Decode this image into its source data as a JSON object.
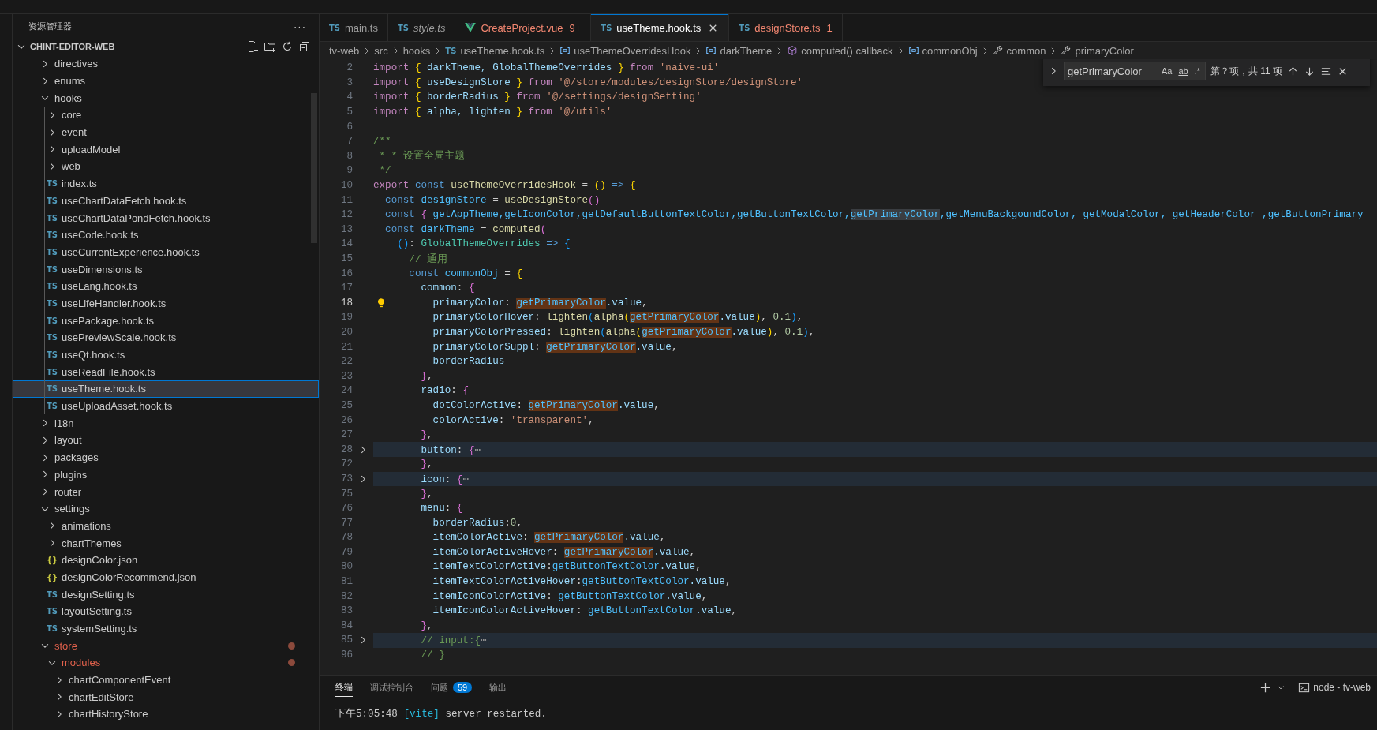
{
  "explorer": {
    "title": "资源管理器",
    "more": "···",
    "project": {
      "name": "CHINT-EDITOR-WEB",
      "expanded": true
    },
    "tree": [
      {
        "label": "directives",
        "kind": "folder",
        "expanded": false,
        "selected": false,
        "modified": false
      },
      {
        "label": "enums",
        "kind": "folder",
        "expanded": false,
        "selected": false,
        "modified": false
      },
      {
        "label": "hooks",
        "kind": "folder",
        "expanded": true,
        "selected": false,
        "modified": false,
        "children": [
          {
            "label": "core",
            "kind": "folder",
            "expanded": false,
            "selected": false,
            "modified": false
          },
          {
            "label": "event",
            "kind": "folder",
            "expanded": false,
            "selected": false,
            "modified": false
          },
          {
            "label": "uploadModel",
            "kind": "folder",
            "expanded": false,
            "selected": false,
            "modified": false
          },
          {
            "label": "web",
            "kind": "folder",
            "expanded": false,
            "selected": false,
            "modified": false
          },
          {
            "label": "index.ts",
            "kind": "ts",
            "icon": "TS",
            "selected": false,
            "modified": false
          },
          {
            "label": "useChartDataFetch.hook.ts",
            "kind": "ts",
            "icon": "TS",
            "selected": false,
            "modified": false
          },
          {
            "label": "useChartDataPondFetch.hook.ts",
            "kind": "ts",
            "icon": "TS",
            "selected": false,
            "modified": false
          },
          {
            "label": "useCode.hook.ts",
            "kind": "ts",
            "icon": "TS",
            "selected": false,
            "modified": false
          },
          {
            "label": "useCurrentExperience.hook.ts",
            "kind": "ts",
            "icon": "TS",
            "selected": false,
            "modified": false
          },
          {
            "label": "useDimensions.ts",
            "kind": "ts",
            "icon": "TS",
            "selected": false,
            "modified": false
          },
          {
            "label": "useLang.hook.ts",
            "kind": "ts",
            "icon": "TS",
            "selected": false,
            "modified": false
          },
          {
            "label": "useLifeHandler.hook.ts",
            "kind": "ts",
            "icon": "TS",
            "selected": false,
            "modified": false
          },
          {
            "label": "usePackage.hook.ts",
            "kind": "ts",
            "icon": "TS",
            "selected": false,
            "modified": false
          },
          {
            "label": "usePreviewScale.hook.ts",
            "kind": "ts",
            "icon": "TS",
            "selected": false,
            "modified": false
          },
          {
            "label": "useQt.hook.ts",
            "kind": "ts",
            "icon": "TS",
            "selected": false,
            "modified": false
          },
          {
            "label": "useReadFile.hook.ts",
            "kind": "ts",
            "icon": "TS",
            "selected": false,
            "modified": false
          },
          {
            "label": "useTheme.hook.ts",
            "kind": "ts",
            "icon": "TS",
            "selected": true,
            "modified": false
          },
          {
            "label": "useUploadAsset.hook.ts",
            "kind": "ts",
            "icon": "TS",
            "selected": false,
            "modified": false
          }
        ]
      },
      {
        "label": "i18n",
        "kind": "folder",
        "expanded": false,
        "selected": false,
        "modified": false
      },
      {
        "label": "layout",
        "kind": "folder",
        "expanded": false,
        "selected": false,
        "modified": false
      },
      {
        "label": "packages",
        "kind": "folder",
        "expanded": false,
        "selected": false,
        "modified": false
      },
      {
        "label": "plugins",
        "kind": "folder",
        "expanded": false,
        "selected": false,
        "modified": false
      },
      {
        "label": "router",
        "kind": "folder",
        "expanded": false,
        "selected": false,
        "modified": false
      },
      {
        "label": "settings",
        "kind": "folder",
        "expanded": true,
        "selected": false,
        "modified": false,
        "children": [
          {
            "label": "animations",
            "kind": "folder",
            "expanded": false,
            "selected": false,
            "modified": false
          },
          {
            "label": "chartThemes",
            "kind": "folder",
            "expanded": false,
            "selected": false,
            "modified": false
          },
          {
            "label": "designColor.json",
            "kind": "json",
            "icon": "{}",
            "selected": false,
            "modified": false
          },
          {
            "label": "designColorRecommend.json",
            "kind": "json",
            "icon": "{}",
            "selected": false,
            "modified": false
          },
          {
            "label": "designSetting.ts",
            "kind": "ts",
            "icon": "TS",
            "selected": false,
            "modified": false
          },
          {
            "label": "layoutSetting.ts",
            "kind": "ts",
            "icon": "TS",
            "selected": false,
            "modified": false
          },
          {
            "label": "systemSetting.ts",
            "kind": "ts",
            "icon": "TS",
            "selected": false,
            "modified": false
          }
        ]
      },
      {
        "label": "store",
        "kind": "folder",
        "expanded": true,
        "selected": false,
        "modified": true,
        "children": [
          {
            "label": "modules",
            "kind": "folder",
            "expanded": true,
            "selected": false,
            "modified": true,
            "children": [
              {
                "label": "chartComponentEvent",
                "kind": "folder",
                "expanded": false,
                "selected": false,
                "modified": false
              },
              {
                "label": "chartEditStore",
                "kind": "folder",
                "expanded": false,
                "selected": false,
                "modified": false
              },
              {
                "label": "chartHistoryStore",
                "kind": "folder",
                "expanded": false,
                "selected": false,
                "modified": false
              }
            ]
          }
        ]
      }
    ]
  },
  "tabs": [
    {
      "label": "main.ts",
      "kind": "ts",
      "icon": "TS",
      "selected": false,
      "preview": false,
      "error": false
    },
    {
      "label": "style.ts",
      "kind": "ts",
      "icon": "TS",
      "selected": false,
      "preview": true,
      "error": false
    },
    {
      "label": "CreateProject.vue",
      "kind": "vue",
      "selected": false,
      "preview": false,
      "error": true,
      "problems": "9+"
    },
    {
      "label": "useTheme.hook.ts",
      "kind": "ts",
      "icon": "TS",
      "selected": true,
      "preview": false,
      "error": false
    },
    {
      "label": "designStore.ts",
      "kind": "ts",
      "icon": "TS",
      "selected": false,
      "preview": false,
      "error": true,
      "problems": "1"
    }
  ],
  "breadcrumb": [
    {
      "label": "tv-web",
      "kind": "folder"
    },
    {
      "label": "src",
      "kind": "folder"
    },
    {
      "label": "hooks",
      "kind": "folder"
    },
    {
      "label": "useTheme.hook.ts",
      "kind": "ts",
      "icon": "TS"
    },
    {
      "label": "useThemeOverridesHook",
      "kind": "variable"
    },
    {
      "label": "darkTheme",
      "kind": "variable"
    },
    {
      "label": "computed() callback",
      "kind": "method"
    },
    {
      "label": "commonObj",
      "kind": "variable"
    },
    {
      "label": "common",
      "kind": "property"
    },
    {
      "label": "primaryColor",
      "kind": "property"
    }
  ],
  "find": {
    "query": "getPrimaryColor",
    "options": [
      {
        "label": "Aa",
        "on": false
      },
      {
        "label": "ab",
        "on": false
      },
      {
        "label": ".*",
        "on": false
      }
    ],
    "result": "第？项，共 11 项"
  },
  "editor": {
    "lines": [
      {
        "number": "2",
        "tokens": [
          {
            "text": "import ",
            "kind": "ctl"
          },
          {
            "text": "{",
            "kind": "b1"
          },
          {
            "text": " darkTheme, GlobalThemeOverrides ",
            "kind": "var"
          },
          {
            "text": "}",
            "kind": "b1"
          },
          {
            "text": " from ",
            "kind": "ctl"
          },
          {
            "text": "'naive-ui'",
            "kind": "str"
          }
        ]
      },
      {
        "number": "3",
        "tokens": [
          {
            "text": "import ",
            "kind": "ctl"
          },
          {
            "text": "{",
            "kind": "b1"
          },
          {
            "text": " useDesignStore ",
            "kind": "var"
          },
          {
            "text": "}",
            "kind": "b1"
          },
          {
            "text": " from ",
            "kind": "ctl"
          },
          {
            "text": "'@/store/modules/designStore/designStore'",
            "kind": "str"
          }
        ]
      },
      {
        "number": "4",
        "tokens": [
          {
            "text": "import ",
            "kind": "ctl"
          },
          {
            "text": "{",
            "kind": "b1"
          },
          {
            "text": " borderRadius ",
            "kind": "var"
          },
          {
            "text": "}",
            "kind": "b1"
          },
          {
            "text": " from ",
            "kind": "ctl"
          },
          {
            "text": "'@/settings/designSetting'",
            "kind": "str"
          }
        ]
      },
      {
        "number": "5",
        "tokens": [
          {
            "text": "import ",
            "kind": "ctl"
          },
          {
            "text": "{",
            "kind": "b1"
          },
          {
            "text": " alpha, lighten ",
            "kind": "var"
          },
          {
            "text": "}",
            "kind": "b1"
          },
          {
            "text": " from ",
            "kind": "ctl"
          },
          {
            "text": "'@/utils'",
            "kind": "str"
          }
        ]
      },
      {
        "number": "6"
      },
      {
        "number": "7",
        "tokens": [
          {
            "text": "/**",
            "kind": "com"
          }
        ]
      },
      {
        "number": "8",
        "tokens": [
          {
            "text": " * * 设置全局主题",
            "kind": "com"
          }
        ]
      },
      {
        "number": "9",
        "tokens": [
          {
            "text": " */",
            "kind": "com"
          }
        ]
      },
      {
        "number": "10",
        "tokens": [
          {
            "text": "export ",
            "kind": "ctl"
          },
          {
            "text": "const ",
            "kind": "kw"
          },
          {
            "text": "useThemeOverridesHook",
            "kind": "fn"
          },
          {
            "text": " = ",
            "kind": "p"
          },
          {
            "text": "()",
            "kind": "b1"
          },
          {
            "text": " => ",
            "kind": "kw"
          },
          {
            "text": "{",
            "kind": "b1"
          }
        ]
      },
      {
        "number": "11",
        "tokens": [
          {
            "text": "  const ",
            "kind": "kw"
          },
          {
            "text": "designStore",
            "kind": "const"
          },
          {
            "text": " = ",
            "kind": "p"
          },
          {
            "text": "useDesignStore",
            "kind": "fn"
          },
          {
            "text": "()",
            "kind": "b2"
          }
        ]
      },
      {
        "number": "12",
        "tokens": [
          {
            "text": "  const ",
            "kind": "kw"
          },
          {
            "text": "{",
            "kind": "b2"
          },
          {
            "text": " getAppTheme,getIconColor,getDefaultButtonTextColor,getButtonTextColor,",
            "kind": "const"
          },
          {
            "text": "getPrimaryColor",
            "kind": "const",
            "match": true,
            "current": true
          },
          {
            "text": ",getMenuBackgoundColor, getModalColor, getHeaderColor ,getButtonPrimary",
            "kind": "const"
          }
        ]
      },
      {
        "number": "13",
        "tokens": [
          {
            "text": "  const ",
            "kind": "kw"
          },
          {
            "text": "darkTheme",
            "kind": "const"
          },
          {
            "text": " = ",
            "kind": "p"
          },
          {
            "text": "computed",
            "kind": "fn"
          },
          {
            "text": "(",
            "kind": "b2"
          }
        ]
      },
      {
        "number": "14",
        "tokens": [
          {
            "text": "    ()",
            "kind": "b3"
          },
          {
            "text": ": ",
            "kind": "p"
          },
          {
            "text": "GlobalThemeOverrides",
            "kind": "type"
          },
          {
            "text": " => ",
            "kind": "kw"
          },
          {
            "text": "{",
            "kind": "b3"
          }
        ]
      },
      {
        "number": "15",
        "tokens": [
          {
            "text": "      // 通用",
            "kind": "com"
          }
        ]
      },
      {
        "number": "16",
        "tokens": [
          {
            "text": "      const ",
            "kind": "kw"
          },
          {
            "text": "commonObj",
            "kind": "const"
          },
          {
            "text": " = ",
            "kind": "p"
          },
          {
            "text": "{",
            "kind": "b1"
          }
        ]
      },
      {
        "number": "17",
        "tokens": [
          {
            "text": "        common",
            "kind": "var"
          },
          {
            "text": ": ",
            "kind": "p"
          },
          {
            "text": "{",
            "kind": "b2"
          }
        ]
      },
      {
        "number": "18",
        "current": true,
        "lightbulb": true,
        "tokens": [
          {
            "text": "          primaryColor",
            "kind": "var"
          },
          {
            "text": ": ",
            "kind": "p"
          },
          {
            "text": "getPrimaryColor",
            "kind": "const",
            "match": true
          },
          {
            "text": ".value",
            "kind": "var"
          },
          {
            "text": ",",
            "kind": "p"
          }
        ]
      },
      {
        "number": "19",
        "tokens": [
          {
            "text": "          primaryColorHover",
            "kind": "var"
          },
          {
            "text": ": ",
            "kind": "p"
          },
          {
            "text": "lighten",
            "kind": "fn"
          },
          {
            "text": "(",
            "kind": "b3"
          },
          {
            "text": "alpha",
            "kind": "fn"
          },
          {
            "text": "(",
            "kind": "b1"
          },
          {
            "text": "getPrimaryColor",
            "kind": "const",
            "match": true
          },
          {
            "text": ".value",
            "kind": "var"
          },
          {
            "text": ")",
            "kind": "b1"
          },
          {
            "text": ", ",
            "kind": "p"
          },
          {
            "text": "0.1",
            "kind": "num"
          },
          {
            "text": ")",
            "kind": "b3"
          },
          {
            "text": ",",
            "kind": "p"
          }
        ]
      },
      {
        "number": "20",
        "tokens": [
          {
            "text": "          primaryColorPressed",
            "kind": "var"
          },
          {
            "text": ": ",
            "kind": "p"
          },
          {
            "text": "lighten",
            "kind": "fn"
          },
          {
            "text": "(",
            "kind": "b3"
          },
          {
            "text": "alpha",
            "kind": "fn"
          },
          {
            "text": "(",
            "kind": "b1"
          },
          {
            "text": "getPrimaryColor",
            "kind": "const",
            "match": true
          },
          {
            "text": ".value",
            "kind": "var"
          },
          {
            "text": ")",
            "kind": "b1"
          },
          {
            "text": ", ",
            "kind": "p"
          },
          {
            "text": "0.1",
            "kind": "num"
          },
          {
            "text": ")",
            "kind": "b3"
          },
          {
            "text": ",",
            "kind": "p"
          }
        ]
      },
      {
        "number": "21",
        "tokens": [
          {
            "text": "          primaryColorSuppl",
            "kind": "var"
          },
          {
            "text": ": ",
            "kind": "p"
          },
          {
            "text": "getPrimaryColor",
            "kind": "const",
            "match": true
          },
          {
            "text": ".value",
            "kind": "var"
          },
          {
            "text": ",",
            "kind": "p"
          }
        ]
      },
      {
        "number": "22",
        "tokens": [
          {
            "text": "          borderRadius",
            "kind": "var"
          }
        ]
      },
      {
        "number": "23",
        "tokens": [
          {
            "text": "        }",
            "kind": "b2"
          },
          {
            "text": ",",
            "kind": "p"
          }
        ]
      },
      {
        "number": "24",
        "tokens": [
          {
            "text": "        radio",
            "kind": "var"
          },
          {
            "text": ": ",
            "kind": "p"
          },
          {
            "text": "{",
            "kind": "b2"
          }
        ]
      },
      {
        "number": "25",
        "tokens": [
          {
            "text": "          dotColorActive",
            "kind": "var"
          },
          {
            "text": ": ",
            "kind": "p"
          },
          {
            "text": "getPrimaryColor",
            "kind": "const",
            "match": true
          },
          {
            "text": ".value",
            "kind": "var"
          },
          {
            "text": ",",
            "kind": "p"
          }
        ]
      },
      {
        "number": "26",
        "tokens": [
          {
            "text": "          colorActive",
            "kind": "var"
          },
          {
            "text": ": ",
            "kind": "p"
          },
          {
            "text": "'transparent'",
            "kind": "str"
          },
          {
            "text": ",",
            "kind": "p"
          }
        ]
      },
      {
        "number": "27",
        "tokens": [
          {
            "text": "        }",
            "kind": "b2"
          },
          {
            "text": ",",
            "kind": "p"
          }
        ]
      },
      {
        "number": "28",
        "folded": true,
        "tokens": [
          {
            "text": "        button",
            "kind": "var"
          },
          {
            "text": ": ",
            "kind": "p"
          },
          {
            "text": "{",
            "kind": "b2"
          },
          {
            "text": "⋯",
            "kind": "ell"
          }
        ]
      },
      {
        "number": "72",
        "tokens": [
          {
            "text": "        }",
            "kind": "b2"
          },
          {
            "text": ",",
            "kind": "p"
          }
        ]
      },
      {
        "number": "73",
        "folded": true,
        "tokens": [
          {
            "text": "        icon",
            "kind": "var"
          },
          {
            "text": ": ",
            "kind": "p"
          },
          {
            "text": "{",
            "kind": "b2"
          },
          {
            "text": "⋯",
            "kind": "ell"
          }
        ]
      },
      {
        "number": "75",
        "tokens": [
          {
            "text": "        }",
            "kind": "b2"
          },
          {
            "text": ",",
            "kind": "p"
          }
        ]
      },
      {
        "number": "76",
        "tokens": [
          {
            "text": "        menu",
            "kind": "var"
          },
          {
            "text": ": ",
            "kind": "p"
          },
          {
            "text": "{",
            "kind": "b2"
          }
        ]
      },
      {
        "number": "77",
        "tokens": [
          {
            "text": "          borderRadius",
            "kind": "var"
          },
          {
            "text": ":",
            "kind": "p"
          },
          {
            "text": "0",
            "kind": "num"
          },
          {
            "text": ",",
            "kind": "p"
          }
        ]
      },
      {
        "number": "78",
        "tokens": [
          {
            "text": "          itemColorActive",
            "kind": "var"
          },
          {
            "text": ": ",
            "kind": "p"
          },
          {
            "text": "getPrimaryColor",
            "kind": "const",
            "match": true
          },
          {
            "text": ".value",
            "kind": "var"
          },
          {
            "text": ",",
            "kind": "p"
          }
        ]
      },
      {
        "number": "79",
        "tokens": [
          {
            "text": "          itemColorActiveHover",
            "kind": "var"
          },
          {
            "text": ": ",
            "kind": "p"
          },
          {
            "text": "getPrimaryColor",
            "kind": "const",
            "match": true
          },
          {
            "text": ".value",
            "kind": "var"
          },
          {
            "text": ",",
            "kind": "p"
          }
        ]
      },
      {
        "number": "80",
        "tokens": [
          {
            "text": "          itemTextColorActive",
            "kind": "var"
          },
          {
            "text": ":",
            "kind": "p"
          },
          {
            "text": "getButtonTextColor",
            "kind": "const"
          },
          {
            "text": ".value",
            "kind": "var"
          },
          {
            "text": ",",
            "kind": "p"
          }
        ]
      },
      {
        "number": "81",
        "tokens": [
          {
            "text": "          itemTextColorActiveHover",
            "kind": "var"
          },
          {
            "text": ":",
            "kind": "p"
          },
          {
            "text": "getButtonTextColor",
            "kind": "const"
          },
          {
            "text": ".value",
            "kind": "var"
          },
          {
            "text": ",",
            "kind": "p"
          }
        ]
      },
      {
        "number": "82",
        "tokens": [
          {
            "text": "          itemIconColorActive",
            "kind": "var"
          },
          {
            "text": ": ",
            "kind": "p"
          },
          {
            "text": "getButtonTextColor",
            "kind": "const"
          },
          {
            "text": ".value",
            "kind": "var"
          },
          {
            "text": ",",
            "kind": "p"
          }
        ]
      },
      {
        "number": "83",
        "tokens": [
          {
            "text": "          itemIconColorActiveHover",
            "kind": "var"
          },
          {
            "text": ": ",
            "kind": "p"
          },
          {
            "text": "getButtonTextColor",
            "kind": "const"
          },
          {
            "text": ".value",
            "kind": "var"
          },
          {
            "text": ",",
            "kind": "p"
          }
        ]
      },
      {
        "number": "84",
        "tokens": [
          {
            "text": "        }",
            "kind": "b2"
          },
          {
            "text": ",",
            "kind": "p"
          }
        ]
      },
      {
        "number": "85",
        "folded": true,
        "tokens": [
          {
            "text": "        // input:{",
            "kind": "com"
          },
          {
            "text": "⋯",
            "kind": "ell"
          }
        ]
      },
      {
        "number": "96",
        "tokens": [
          {
            "text": "        // }",
            "kind": "com"
          }
        ]
      }
    ]
  },
  "panel": {
    "tabs": [
      {
        "label": "终端",
        "selected": true
      },
      {
        "label": "调试控制台",
        "selected": false
      },
      {
        "label": "问题",
        "selected": false,
        "badge": "59"
      },
      {
        "label": "输出",
        "selected": false
      }
    ],
    "terminal_name": "node - tv-web",
    "lines": [
      {
        "time": "下午5:05:48",
        "tag": "[vite]",
        "message": "server restarted."
      }
    ]
  }
}
